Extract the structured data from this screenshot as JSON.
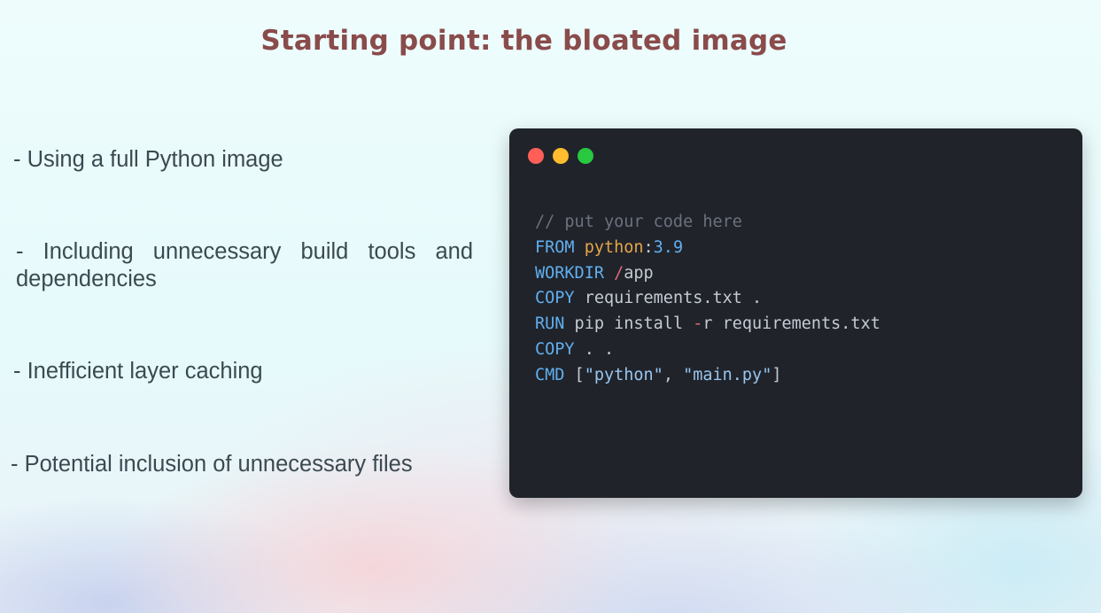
{
  "slide": {
    "title": "Starting point: the bloated image",
    "bullets": [
      "- Using a full Python image",
      "- Including unnecessary build tools and dependencies",
      "- Inefficient layer caching",
      "- Potential inclusion of unnecessary files"
    ]
  },
  "code_window": {
    "window_controls": [
      {
        "name": "close",
        "color": "#ff5f57"
      },
      {
        "name": "minimize",
        "color": "#febc2e"
      },
      {
        "name": "maximize",
        "color": "#28c840"
      }
    ],
    "colors": {
      "background": "#20232a",
      "comment": "#6b717d",
      "keyword": "#61afef",
      "image_name": "#e5a54a",
      "number": "#61afef",
      "operator": "#e06c75",
      "string": "#98c6f0",
      "plain": "#c5cbd3"
    },
    "lines": [
      [
        {
          "t": "// put your code here",
          "c": "comment"
        }
      ],
      [
        {
          "t": "FROM",
          "c": "keyword"
        },
        {
          "t": " ",
          "c": "plain"
        },
        {
          "t": "python",
          "c": "image_name"
        },
        {
          "t": ":",
          "c": "plain"
        },
        {
          "t": "3.9",
          "c": "number"
        }
      ],
      [
        {
          "t": "WORKDIR",
          "c": "keyword"
        },
        {
          "t": " ",
          "c": "plain"
        },
        {
          "t": "/",
          "c": "operator"
        },
        {
          "t": "app",
          "c": "plain"
        }
      ],
      [
        {
          "t": "COPY",
          "c": "keyword"
        },
        {
          "t": " requirements.txt .",
          "c": "plain"
        }
      ],
      [
        {
          "t": "RUN",
          "c": "keyword"
        },
        {
          "t": " pip install ",
          "c": "plain"
        },
        {
          "t": "-",
          "c": "operator"
        },
        {
          "t": "r requirements.txt",
          "c": "plain"
        }
      ],
      [
        {
          "t": "COPY",
          "c": "keyword"
        },
        {
          "t": " . .",
          "c": "plain"
        }
      ],
      [
        {
          "t": "CMD",
          "c": "keyword"
        },
        {
          "t": " [",
          "c": "plain"
        },
        {
          "t": "\"python\"",
          "c": "string"
        },
        {
          "t": ", ",
          "c": "plain"
        },
        {
          "t": "\"main.py\"",
          "c": "string"
        },
        {
          "t": "]",
          "c": "plain"
        }
      ]
    ]
  }
}
